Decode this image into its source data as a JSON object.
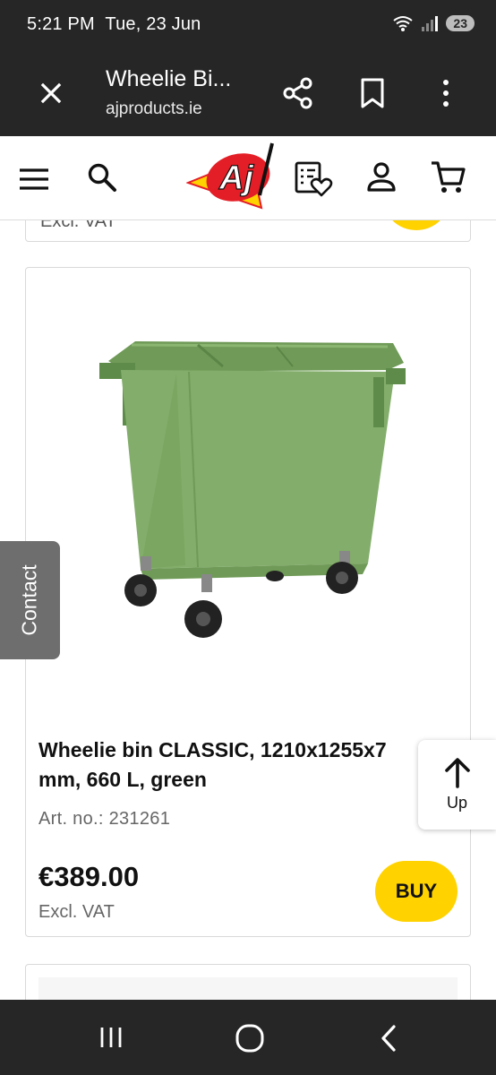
{
  "status_bar": {
    "time": "5:21 PM",
    "date": "Tue, 23 Jun",
    "battery": "23",
    "icons": [
      "wifi-icon",
      "signal-icon",
      "battery-icon"
    ]
  },
  "browser": {
    "title": "Wheelie Bi...",
    "url": "ajproducts.ie",
    "icons": [
      "close-icon",
      "share-icon",
      "bookmark-icon",
      "more-vertical-icon"
    ]
  },
  "site_header": {
    "logo_text": "Aj",
    "icons": [
      "menu-icon",
      "search-icon",
      "shopping-list-heart-icon",
      "user-icon",
      "cart-icon"
    ]
  },
  "previous_card": {
    "excl_vat": "Excl. VAT"
  },
  "product": {
    "title": "Wheelie bin CLASSIC, 1210x1255x7... mm, 660 L, green",
    "title_line1": "Wheelie bin CLASSIC, 1210x1255x7",
    "title_line2": "mm, 660 L, green",
    "art_no": "Art. no.: 231261",
    "price": "€389.00",
    "excl_vat": "Excl. VAT",
    "buy_label": "BUY",
    "color": "#7fa865"
  },
  "floating": {
    "contact_label": "Contact",
    "up_label": "Up"
  },
  "colors": {
    "dark_bar": "#262626",
    "accent_yellow": "#ffd200",
    "logo_red": "#e41e26"
  },
  "nav_bar": {
    "icons": [
      "recents-icon",
      "home-icon",
      "back-icon"
    ]
  }
}
